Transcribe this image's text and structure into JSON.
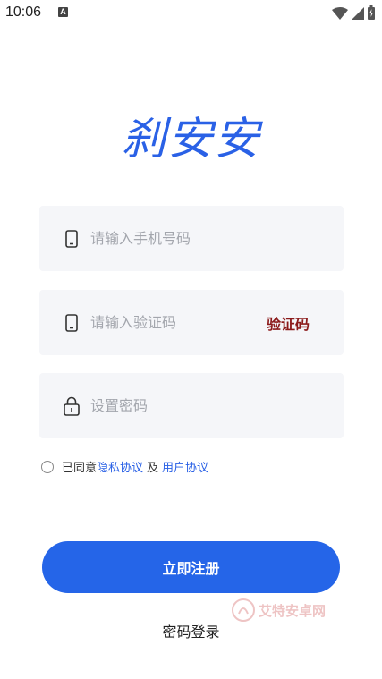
{
  "status_bar": {
    "time": "10:06",
    "notification_badge": "A",
    "icons": [
      "wifi-icon",
      "signal-icon",
      "battery-icon"
    ]
  },
  "brand": {
    "title": "刹安安",
    "color": "#2a61e6"
  },
  "form": {
    "phone_placeholder": "请输入手机号码",
    "code_placeholder": "请输入验证码",
    "code_button": "验证码",
    "password_placeholder": "设置密码"
  },
  "agreement": {
    "prefix": "已同意",
    "privacy_link": "隐私协议",
    "conjunction": "及",
    "user_link": "用户协议"
  },
  "actions": {
    "register": "立即注册",
    "password_login": "密码登录"
  },
  "watermark": {
    "text": "艾特安卓网"
  },
  "colors": {
    "accent": "#2565e8",
    "code_button": "#8b1a1a",
    "field_bg": "#f5f6f9"
  }
}
